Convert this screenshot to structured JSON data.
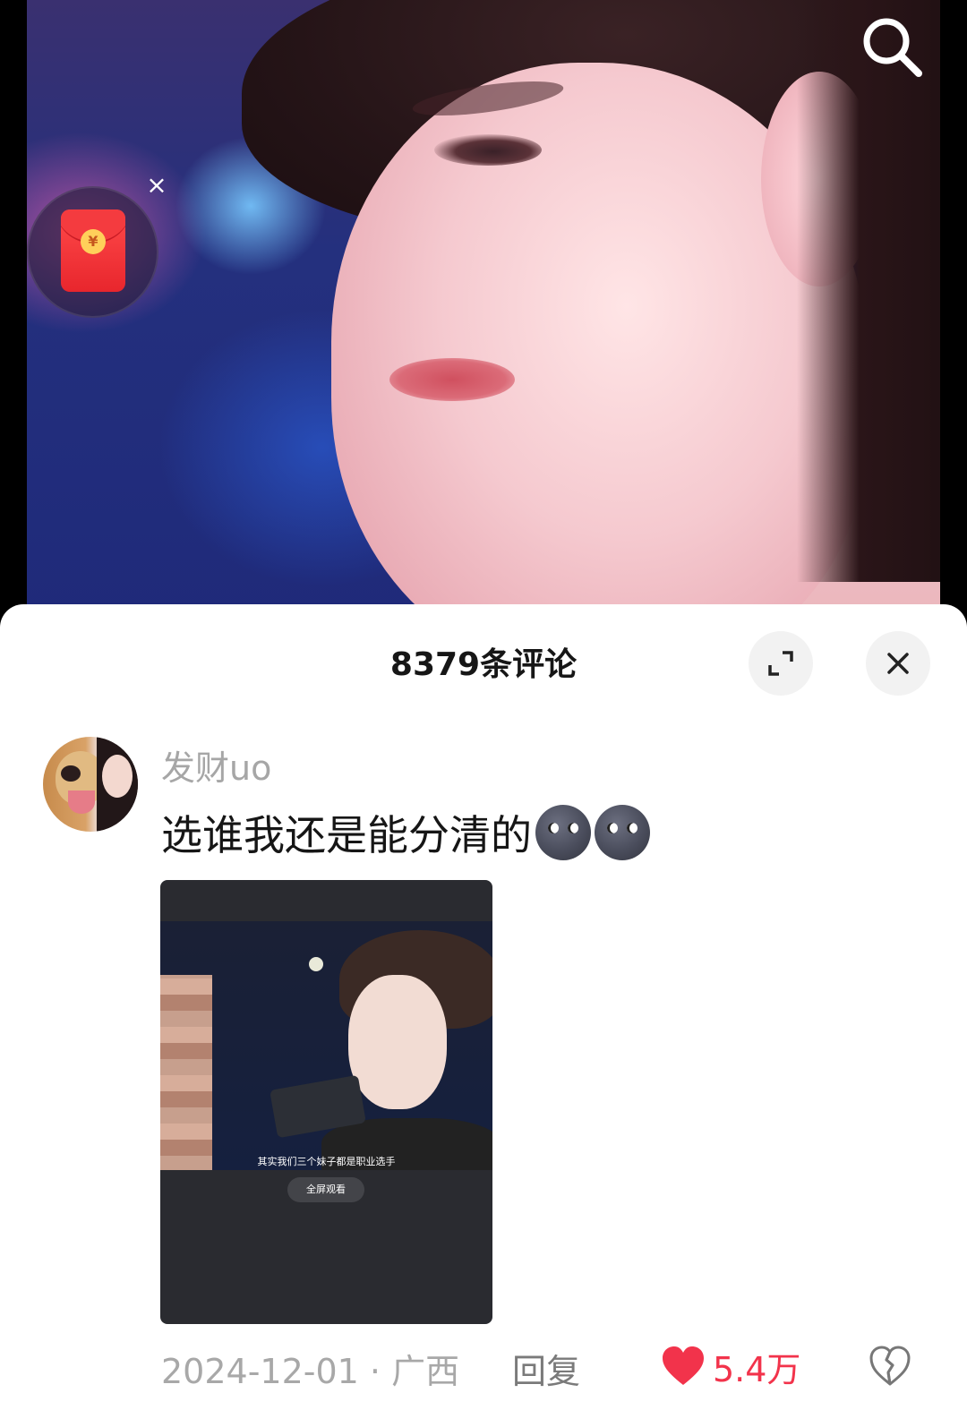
{
  "sheet": {
    "title": "8379条评论"
  },
  "comment": {
    "username": "发财uo",
    "text": "选谁我还是能分清的",
    "emoji": [
      "new-moon-face",
      "new-moon-face"
    ],
    "thumbnail": {
      "subtitle": "其实我们三个妹子都是职业选手",
      "fullscreen_label": "全屏观看"
    },
    "date_location": "2024-12-01 · 广西",
    "reply_label": "回复",
    "like_count": "5.4万"
  },
  "colors": {
    "like_red": "#f2334b",
    "redpacket": "#e8262d"
  },
  "icons": [
    "search-icon",
    "red-packet-icon",
    "close-icon",
    "expand-icon",
    "heart-icon",
    "broken-heart-icon"
  ]
}
